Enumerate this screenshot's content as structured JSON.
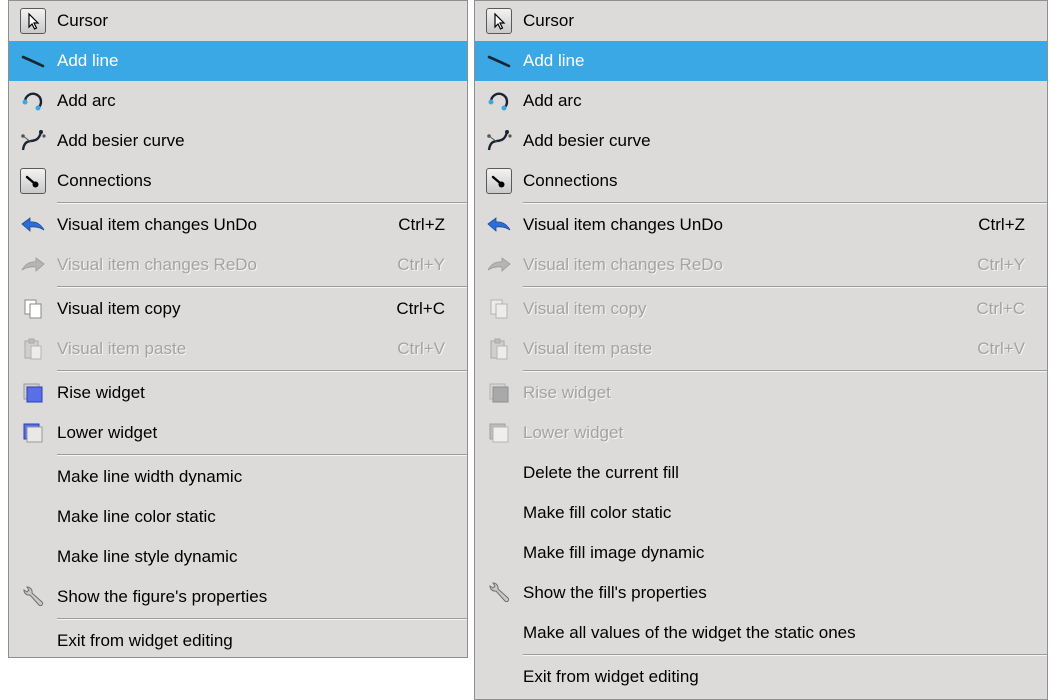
{
  "left_menu": {
    "items": [
      {
        "label": "Cursor",
        "icon": "cursor-icon"
      },
      {
        "label": "Add line",
        "icon": "line-icon"
      },
      {
        "label": "Add arc",
        "icon": "arc-icon"
      },
      {
        "label": "Add besier curve",
        "icon": "bezier-icon"
      },
      {
        "label": "Connections",
        "icon": "connections-icon"
      },
      {
        "label": "Visual item changes UnDo",
        "shortcut": "Ctrl+Z",
        "icon": "undo-icon"
      },
      {
        "label": "Visual item changes ReDo",
        "shortcut": "Ctrl+Y",
        "icon": "redo-icon"
      },
      {
        "label": "Visual item copy",
        "shortcut": "Ctrl+C",
        "icon": "copy-icon"
      },
      {
        "label": "Visual item paste",
        "shortcut": "Ctrl+V",
        "icon": "paste-icon"
      },
      {
        "label": "Rise widget",
        "icon": "raise-icon"
      },
      {
        "label": "Lower widget",
        "icon": "lower-icon"
      },
      {
        "label": "Make line width dynamic"
      },
      {
        "label": "Make line color static"
      },
      {
        "label": "Make line style dynamic"
      },
      {
        "label": "Show the figure's properties",
        "icon": "wrench-icon"
      },
      {
        "label": "Exit from widget editing"
      }
    ]
  },
  "right_menu": {
    "items": [
      {
        "label": "Cursor",
        "icon": "cursor-icon"
      },
      {
        "label": "Add line",
        "icon": "line-icon"
      },
      {
        "label": "Add arc",
        "icon": "arc-icon"
      },
      {
        "label": "Add besier curve",
        "icon": "bezier-icon"
      },
      {
        "label": "Connections",
        "icon": "connections-icon"
      },
      {
        "label": "Visual item changes UnDo",
        "shortcut": "Ctrl+Z",
        "icon": "undo-icon"
      },
      {
        "label": "Visual item changes ReDo",
        "shortcut": "Ctrl+Y",
        "icon": "redo-icon"
      },
      {
        "label": "Visual item copy",
        "shortcut": "Ctrl+C",
        "icon": "copy-icon"
      },
      {
        "label": "Visual item paste",
        "shortcut": "Ctrl+V",
        "icon": "paste-icon"
      },
      {
        "label": "Rise widget",
        "icon": "raise-icon"
      },
      {
        "label": "Lower widget",
        "icon": "lower-icon"
      },
      {
        "label": "Delete the current fill"
      },
      {
        "label": "Make fill color static"
      },
      {
        "label": "Make fill image dynamic"
      },
      {
        "label": "Show the fill's properties",
        "icon": "wrench-icon"
      },
      {
        "label": "Make all values of the widget the static ones"
      },
      {
        "label": "Exit from widget editing"
      }
    ]
  },
  "colors": {
    "menu_bg": "#dcdbd9",
    "selection": "#39a8e4",
    "disabled_text": "#a3a3a3"
  }
}
